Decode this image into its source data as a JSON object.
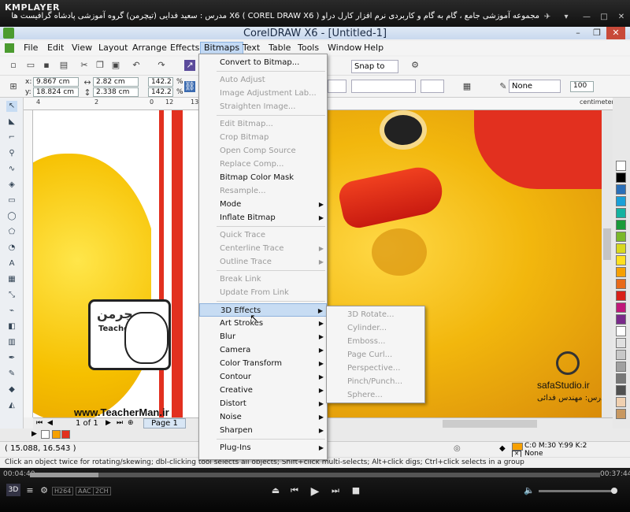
{
  "player": {
    "logo": "KMPLAYER",
    "title": "مجموعه آموزشی جامع ، گام به گام و کاربردی نرم افزار کارل دراو X6 ( COREL DRAW X6 )  مدرس : سعید فدایی (تیچرمن) گروه آموزشی پادشاه گرافیست ها",
    "time_elapsed": "00:04:40",
    "time_total": "00:37:44",
    "progress": 0.12,
    "badges": [
      "H264",
      "AAC",
      "2CH"
    ],
    "logo3d": "3D"
  },
  "app": {
    "title": "CorelDRAW X6 - [Untitled-1]"
  },
  "menubar": [
    "File",
    "Edit",
    "View",
    "Layout",
    "Arrange",
    "Effects",
    "Bitmaps",
    "Text",
    "Table",
    "Tools",
    "Window",
    "Help"
  ],
  "toolbar": {
    "snap_to": "Snap to"
  },
  "propbar": {
    "x": "9.867 cm",
    "y": "18.824 cm",
    "w": "2.82 cm",
    "h": "2.338 cm",
    "scale_x": "142.2",
    "scale_y": "142.2",
    "pct": "%",
    "outline": "None",
    "zoom_val": "100",
    "units": "centimeters"
  },
  "ruler": {
    "ticks": [
      "4",
      "2",
      "0",
      "12",
      "13"
    ],
    "units": "centimeters"
  },
  "bitmaps_menu": [
    {
      "label": "Convert to Bitmap...",
      "enabled": true
    },
    {
      "sep": true
    },
    {
      "label": "Auto Adjust",
      "enabled": false
    },
    {
      "label": "Image Adjustment Lab...",
      "enabled": false
    },
    {
      "label": "Straighten Image...",
      "enabled": false
    },
    {
      "sep": true
    },
    {
      "label": "Edit Bitmap...",
      "enabled": false
    },
    {
      "label": "Crop Bitmap",
      "enabled": false
    },
    {
      "label": "Open Comp Source",
      "enabled": false
    },
    {
      "label": "Replace Comp...",
      "enabled": false
    },
    {
      "label": "Bitmap Color Mask",
      "enabled": true
    },
    {
      "label": "Resample...",
      "enabled": false
    },
    {
      "label": "Mode",
      "enabled": true,
      "sub": true
    },
    {
      "label": "Inflate Bitmap",
      "enabled": true,
      "sub": true
    },
    {
      "sep": true
    },
    {
      "label": "Quick Trace",
      "enabled": false
    },
    {
      "label": "Centerline Trace",
      "enabled": false,
      "sub": true
    },
    {
      "label": "Outline Trace",
      "enabled": false,
      "sub": true
    },
    {
      "sep": true
    },
    {
      "label": "Break Link",
      "enabled": false
    },
    {
      "label": "Update From Link",
      "enabled": false
    },
    {
      "sep": true
    },
    {
      "label": "3D Effects",
      "enabled": true,
      "sub": true,
      "highlight": true
    },
    {
      "label": "Art Strokes",
      "enabled": true,
      "sub": true
    },
    {
      "label": "Blur",
      "enabled": true,
      "sub": true
    },
    {
      "label": "Camera",
      "enabled": true,
      "sub": true
    },
    {
      "label": "Color Transform",
      "enabled": true,
      "sub": true
    },
    {
      "label": "Contour",
      "enabled": true,
      "sub": true
    },
    {
      "label": "Creative",
      "enabled": true,
      "sub": true
    },
    {
      "label": "Distort",
      "enabled": true,
      "sub": true
    },
    {
      "label": "Noise",
      "enabled": true,
      "sub": true
    },
    {
      "label": "Sharpen",
      "enabled": true,
      "sub": true
    },
    {
      "sep": true
    },
    {
      "label": "Plug-Ins",
      "enabled": true,
      "sub": true
    }
  ],
  "submenu_3d": [
    "3D Rotate...",
    "Cylinder...",
    "Emboss...",
    "Page Curl...",
    "Perspective...",
    "Pinch/Punch...",
    "Sphere..."
  ],
  "pagebar": {
    "page_count": "1 of 1",
    "page_tab": "Page 1"
  },
  "status": {
    "coords": "( 15.088, 16.543 )",
    "fill": "C:0 M:30 Y:99 K:2",
    "outline": "None",
    "hint": "Click an object twice for rotating/skewing; dbl-clicking tool selects all objects; Shift+click multi-selects; Alt+click digs; Ctrl+click selects in a group"
  },
  "watermarks": {
    "teacherman_fa": "تیچرمن",
    "teacherman_en": "TeacherMan",
    "site": "www.TeacherMan.ir",
    "safa": "safaStudio.ir",
    "instructor": "مدرس: مهندس فدائی"
  },
  "colors": {
    "accent_fill": "#f6a000",
    "duck_yellow": "#f2b70d",
    "beak_red": "#e2301f",
    "menu_highlight": "#c7dcf3"
  },
  "palette_colors": [
    "#ffffff",
    "#000000",
    "#2b6fb8",
    "#1aa0d8",
    "#14b2a0",
    "#1a9a3a",
    "#7ab82a",
    "#d8d820",
    "#ffe020",
    "#f6a000",
    "#e86a1a",
    "#d8201a",
    "#c0187a",
    "#7a2a8a",
    "#ffffff",
    "#e0e0e0",
    "#c8c8c8",
    "#a0a0a0",
    "#787878",
    "#505050",
    "#f0d0b0",
    "#c89860"
  ]
}
